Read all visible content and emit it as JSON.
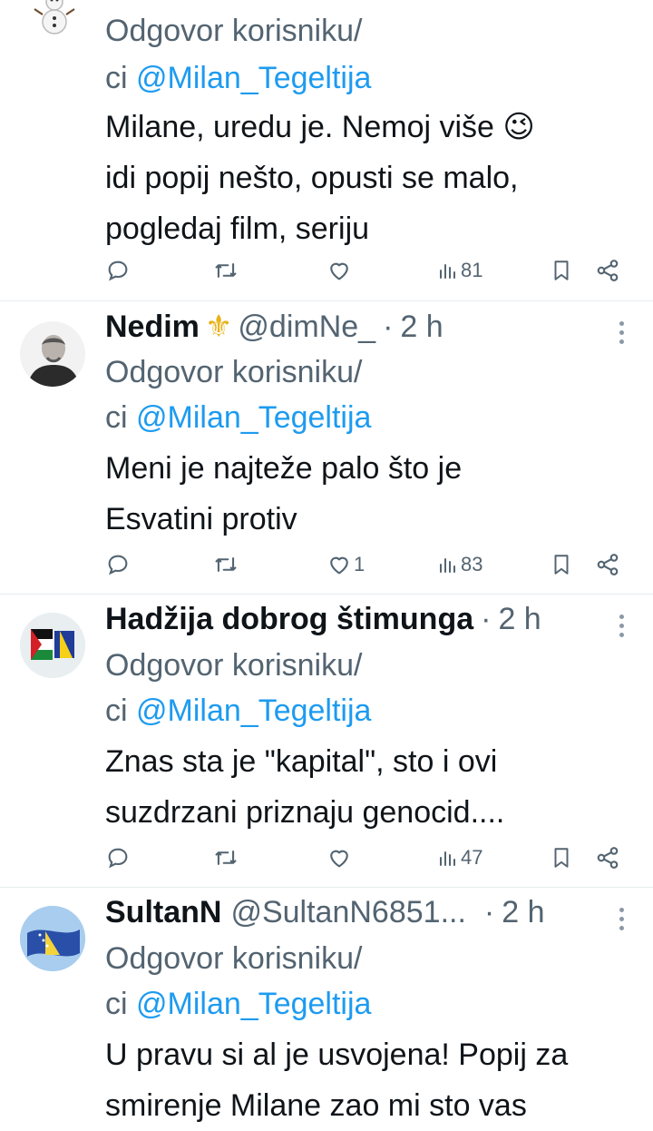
{
  "tweets": [
    {
      "name": "",
      "handle": "",
      "time": "",
      "reply_prefix": "Odgovor korisniku/",
      "reply_prefix2": "ci",
      "mention": "@Milan_Tegeltija",
      "text_lines": [
        "Milane, uredu je. Nemoj više 😉",
        "idi popij nešto, opusti se malo,",
        "pogledaj film, seriju"
      ],
      "replies": "",
      "retweets": "",
      "likes": "",
      "views": "81",
      "avatar_icon": "snowman-icon"
    },
    {
      "name": "Nedim",
      "badge": "⚜",
      "handle": "@dimNe_",
      "dot": "·",
      "time": "2 h",
      "reply_prefix": "Odgovor korisniku/",
      "reply_prefix2": "ci",
      "mention": "@Milan_Tegeltija",
      "text_lines": [
        "Meni je najteže palo što je",
        "Esvatini protiv"
      ],
      "replies": "",
      "retweets": "",
      "likes": "1",
      "views": "83",
      "avatar_icon": "person-photo-icon"
    },
    {
      "name": "Hadžija dobrog štimunga",
      "handle": "",
      "dot": "·",
      "time": "2 h",
      "reply_prefix": "Odgovor korisniku/",
      "reply_prefix2": "ci",
      "mention": "@Milan_Tegeltija",
      "text_lines": [
        "Znas sta je \"kapital\", sto i ovi",
        "suzdrzani priznaju genocid...."
      ],
      "replies": "",
      "retweets": "",
      "likes": "",
      "views": "47",
      "avatar_icon": "flags-icon"
    },
    {
      "name": "SultanN",
      "handle": "@SultanN6851...",
      "dot": "·",
      "time": "2 h",
      "reply_prefix": "Odgovor korisniku/",
      "reply_prefix2": "ci",
      "mention": "@Milan_Tegeltija",
      "text_lines": [
        "U pravu si al je usvojena! Popij za",
        "smirenje Milane zao mi sto vas"
      ],
      "avatar_icon": "bosnia-flag-icon"
    }
  ],
  "colors": {
    "accent": "#1d9bf0",
    "muted": "#536471",
    "text": "#0f1419"
  }
}
